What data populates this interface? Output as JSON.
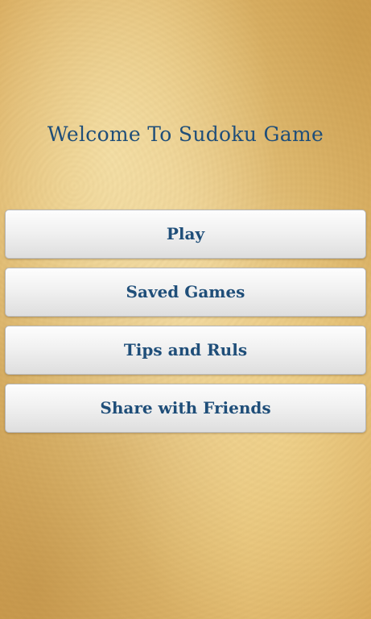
{
  "header": {
    "title": "Welcome To Sudoku Game"
  },
  "menu": {
    "items": [
      {
        "label": "Play"
      },
      {
        "label": "Saved Games"
      },
      {
        "label": "Tips and Ruls"
      },
      {
        "label": "Share with Friends"
      }
    ]
  },
  "colors": {
    "title_text": "#1f4e79",
    "button_text": "#1f4e79",
    "button_background": "#efefef",
    "parchment_background": "#e6c278"
  }
}
